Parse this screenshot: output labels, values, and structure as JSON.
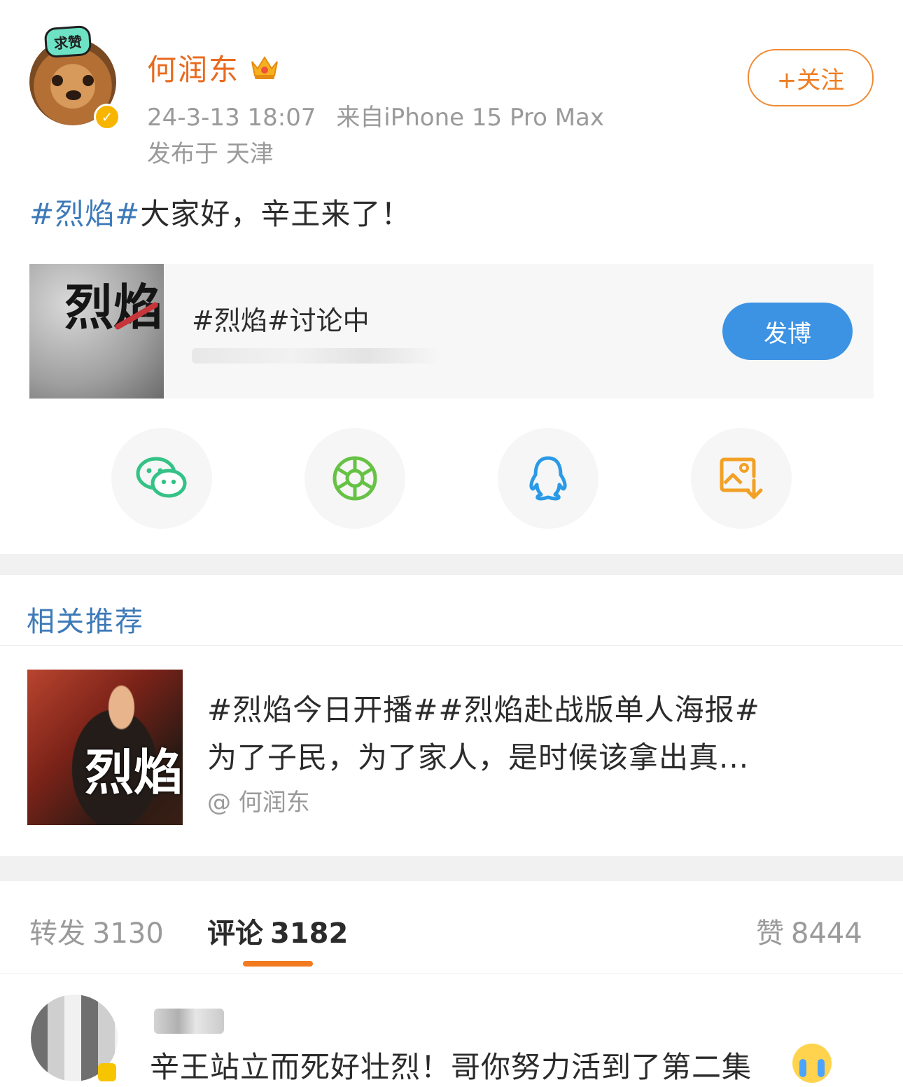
{
  "post": {
    "author_name": "何润东",
    "badge_text": "求赞",
    "verified_mark": "✓",
    "timestamp": "24-3-13 18:07",
    "source": "来自iPhone 15 Pro Max",
    "location": "发布于 天津",
    "follow_label": "+关注",
    "text_tag": "#烈焰#",
    "text_body": "大家好，辛王来了！"
  },
  "topic_card": {
    "title": "#烈焰#讨论中",
    "thumb_text": "烈焰",
    "post_button": "发博"
  },
  "share": {
    "icons": [
      "wechat-icon",
      "moments-icon",
      "qq-icon",
      "save-image-icon"
    ]
  },
  "recommend": {
    "section_title": "相关推荐",
    "item_line1": "#烈焰今日开播##烈焰赴战版单人海报#",
    "item_line2": "为了子民，为了家人，是时候该拿出真...",
    "item_author": "@ 何润东",
    "thumb_text": "烈焰"
  },
  "tabs": {
    "repost_label": "转发",
    "repost_count": "3130",
    "comment_label": "评论",
    "comment_count": "3182",
    "like_label": "赞",
    "like_count": "8444"
  },
  "comment": {
    "text": "辛王站立而死好壮烈！哥你努力活到了第二集"
  },
  "colors": {
    "name_orange": "#e86a1e",
    "tag_blue": "#3d7ab8",
    "button_blue": "#3d93e3",
    "tab_underline": "#f27a1f"
  }
}
